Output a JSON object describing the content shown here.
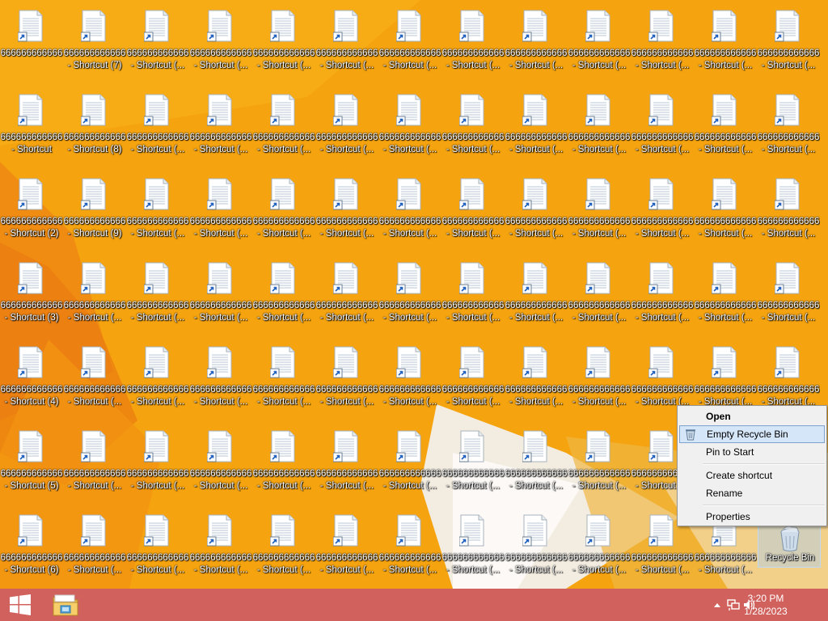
{
  "desktop": {
    "icon_columns": 13,
    "icon_rows": 7,
    "rows": [
      {
        "labels": [
          [
            "666666666666",
            ""
          ],
          [
            "666666666666",
            "- Shortcut (7)"
          ],
          [
            "666666666666",
            "- Shortcut (..."
          ],
          [
            "666666666666",
            "- Shortcut (..."
          ],
          [
            "666666666666",
            "- Shortcut (..."
          ],
          [
            "666666666666",
            "- Shortcut (..."
          ],
          [
            "666666666666",
            "- Shortcut (..."
          ],
          [
            "666666666666",
            "- Shortcut (..."
          ],
          [
            "666666666666",
            "- Shortcut (..."
          ],
          [
            "666666666666",
            "- Shortcut (..."
          ],
          [
            "666666666666",
            "- Shortcut (..."
          ],
          [
            "666666666666",
            "- Shortcut (..."
          ],
          [
            "666666666666",
            "- Shortcut (..."
          ]
        ]
      },
      {
        "labels": [
          [
            "666666666666",
            "- Shortcut"
          ],
          [
            "666666666666",
            "- Shortcut (8)"
          ],
          [
            "666666666666",
            "- Shortcut (..."
          ],
          [
            "666666666666",
            "- Shortcut (..."
          ],
          [
            "666666666666",
            "- Shortcut (..."
          ],
          [
            "666666666666",
            "- Shortcut (..."
          ],
          [
            "666666666666",
            "- Shortcut (..."
          ],
          [
            "666666666666",
            "- Shortcut (..."
          ],
          [
            "666666666666",
            "- Shortcut (..."
          ],
          [
            "666666666666",
            "- Shortcut (..."
          ],
          [
            "666666666666",
            "- Shortcut (..."
          ],
          [
            "666666666666",
            "- Shortcut (..."
          ],
          [
            "666666666666",
            "- Shortcut (..."
          ]
        ]
      },
      {
        "labels": [
          [
            "666666666666",
            "- Shortcut (2)"
          ],
          [
            "666666666666",
            "- Shortcut (9)"
          ],
          [
            "666666666666",
            "- Shortcut (..."
          ],
          [
            "666666666666",
            "- Shortcut (..."
          ],
          [
            "666666666666",
            "- Shortcut (..."
          ],
          [
            "666666666666",
            "- Shortcut (..."
          ],
          [
            "666666666666",
            "- Shortcut (..."
          ],
          [
            "666666666666",
            "- Shortcut (..."
          ],
          [
            "666666666666",
            "- Shortcut (..."
          ],
          [
            "666666666666",
            "- Shortcut (..."
          ],
          [
            "666666666666",
            "- Shortcut (..."
          ],
          [
            "666666666666",
            "- Shortcut (..."
          ],
          [
            "666666666666",
            "- Shortcut (..."
          ]
        ]
      },
      {
        "labels": [
          [
            "666666666666",
            "- Shortcut (3)"
          ],
          [
            "666666666666",
            "- Shortcut (..."
          ],
          [
            "666666666666",
            "- Shortcut (..."
          ],
          [
            "666666666666",
            "- Shortcut (..."
          ],
          [
            "666666666666",
            "- Shortcut (..."
          ],
          [
            "666666666666",
            "- Shortcut (..."
          ],
          [
            "666666666666",
            "- Shortcut (..."
          ],
          [
            "666666666666",
            "- Shortcut (..."
          ],
          [
            "666666666666",
            "- Shortcut (..."
          ],
          [
            "666666666666",
            "- Shortcut (..."
          ],
          [
            "666666666666",
            "- Shortcut (..."
          ],
          [
            "666666666666",
            "- Shortcut (..."
          ],
          [
            "666666666666",
            "- Shortcut (..."
          ]
        ]
      },
      {
        "labels": [
          [
            "666666666666",
            "- Shortcut (4)"
          ],
          [
            "666666666666",
            "- Shortcut (..."
          ],
          [
            "666666666666",
            "- Shortcut (..."
          ],
          [
            "666666666666",
            "- Shortcut (..."
          ],
          [
            "666666666666",
            "- Shortcut (..."
          ],
          [
            "666666666666",
            "- Shortcut (..."
          ],
          [
            "666666666666",
            "- Shortcut (..."
          ],
          [
            "666666666666",
            "- Shortcut (..."
          ],
          [
            "666666666666",
            "- Shortcut (..."
          ],
          [
            "666666666666",
            "- Shortcut (..."
          ],
          [
            "666666666666",
            "- Shortcut (..."
          ],
          [
            "666666666666",
            "- Shortcut (..."
          ],
          [
            "666666666666",
            "- Shortcut (..."
          ]
        ]
      },
      {
        "labels": [
          [
            "666666666666",
            "- Shortcut (5)"
          ],
          [
            "666666666666",
            "- Shortcut (..."
          ],
          [
            "666666666666",
            "- Shortcut (..."
          ],
          [
            "666666666666",
            "- Shortcut (..."
          ],
          [
            "666666666666",
            "- Shortcut (..."
          ],
          [
            "666666666666",
            "- Shortcut (..."
          ],
          [
            "666666666666",
            "- Shortcut (..."
          ],
          [
            "666666666666",
            "- Shortcut (..."
          ],
          [
            "666666666666",
            "- Shortcut (..."
          ],
          [
            "666666666666",
            "- Shortcut (..."
          ],
          [
            "666666666666",
            "- Shortcut (..."
          ]
        ]
      },
      {
        "labels": [
          [
            "666666666666",
            "- Shortcut (6)"
          ],
          [
            "666666666666",
            "- Shortcut (..."
          ],
          [
            "666666666666",
            "- Shortcut (..."
          ],
          [
            "666666666666",
            "- Shortcut (..."
          ],
          [
            "666666666666",
            "- Shortcut (..."
          ],
          [
            "666666666666",
            "- Shortcut (..."
          ],
          [
            "666666666666",
            "- Shortcut (..."
          ],
          [
            "666666666666",
            "- Shortcut (..."
          ],
          [
            "666666666666",
            "- Shortcut (..."
          ],
          [
            "666666666666",
            "- Shortcut (..."
          ],
          [
            "666666666666",
            "- Shortcut (..."
          ],
          [
            "666666666666",
            "- Shortcut (..."
          ]
        ]
      }
    ],
    "recycle_bin": {
      "label": "Recycle Bin",
      "icon": "recycle-bin-icon"
    }
  },
  "context_menu": {
    "items": [
      {
        "label": "Open",
        "bold": true
      },
      {
        "label": "Empty Recycle Bin",
        "highlighted": true,
        "icon": "recycle-bin-icon"
      },
      {
        "label": "Pin to Start"
      },
      {
        "label": "Create shortcut"
      },
      {
        "label": "Rename"
      },
      {
        "label": "Properties"
      }
    ]
  },
  "taskbar": {
    "start_icon": "windows-logo-icon",
    "pinned": [
      {
        "name": "File Explorer",
        "icon": "file-explorer-icon"
      }
    ],
    "tray": {
      "icons": [
        "chevron-up-icon",
        "network-icon",
        "volume-icon"
      ],
      "time": "3:20 PM",
      "date": "1/28/2023"
    }
  },
  "colors": {
    "wallpaper": "#f5a814",
    "taskbar": "#d0615d",
    "menu_bg": "#f0f0f0",
    "menu_highlight": "#d5e6f8"
  }
}
